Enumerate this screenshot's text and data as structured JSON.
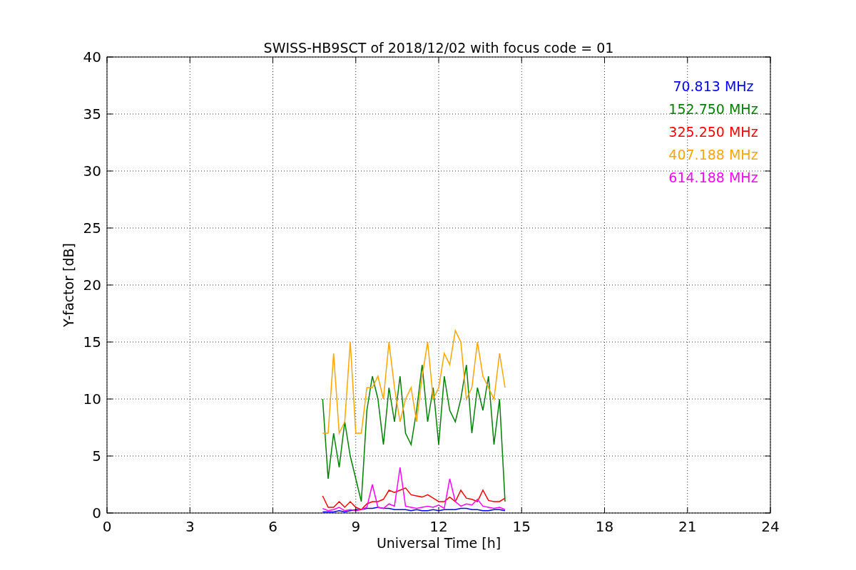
{
  "chart_data": {
    "type": "line",
    "title": "SWISS-HB9SCT of 2018/12/02 with focus code = 01",
    "xlabel": "Universal Time [h]",
    "ylabel": "Y-factor [dB]",
    "x": [
      7.8,
      8.0,
      8.2,
      8.4,
      8.6,
      8.8,
      9.0,
      9.2,
      9.4,
      9.6,
      9.8,
      10.0,
      10.2,
      10.4,
      10.6,
      10.8,
      11.0,
      11.2,
      11.4,
      11.6,
      11.8,
      12.0,
      12.2,
      12.4,
      12.6,
      12.8,
      13.0,
      13.2,
      13.4,
      13.6,
      13.8,
      14.0,
      14.2,
      14.4
    ],
    "series": [
      {
        "name": "70.813 MHz",
        "color": "#0000ff",
        "values": [
          0.1,
          0.1,
          0.1,
          0.2,
          0.1,
          0.2,
          0.3,
          0.3,
          0.4,
          0.4,
          0.5,
          0.4,
          0.4,
          0.3,
          0.3,
          0.3,
          0.2,
          0.3,
          0.2,
          0.2,
          0.3,
          0.2,
          0.3,
          0.3,
          0.3,
          0.4,
          0.4,
          0.3,
          0.3,
          0.2,
          0.2,
          0.3,
          0.3,
          0.2
        ]
      },
      {
        "name": "152.750 MHz",
        "color": "#008000",
        "values": [
          10,
          3,
          7,
          4,
          8,
          5,
          3,
          1,
          9,
          12,
          10,
          6,
          11,
          8,
          12,
          7,
          6,
          9,
          13,
          8,
          11,
          6,
          12,
          9,
          8,
          10,
          13,
          7,
          11,
          9,
          12,
          6,
          10,
          1
        ]
      },
      {
        "name": "325.250 MHz",
        "color": "#ff0000",
        "values": [
          1.5,
          0.5,
          0.5,
          1,
          0.5,
          1,
          0.5,
          0.3,
          0.8,
          1,
          1,
          1.2,
          2,
          1.8,
          2,
          2.2,
          1.6,
          1.5,
          1.4,
          1.6,
          1.3,
          1,
          1,
          1.4,
          1,
          2,
          1.3,
          1.2,
          1,
          2,
          1.1,
          1,
          1,
          1.3
        ]
      },
      {
        "name": "407.188 MHz",
        "color": "#ffa500",
        "values": [
          7,
          7,
          14,
          7,
          8,
          15,
          7,
          7,
          11,
          11,
          12,
          10,
          15,
          11,
          8,
          10,
          11,
          8,
          12,
          15,
          10,
          11,
          14,
          13,
          16,
          15,
          10,
          11,
          15,
          12,
          11,
          10,
          14,
          11
        ]
      },
      {
        "name": "614.188 MHz",
        "color": "#ff00ff",
        "values": [
          0.4,
          0.2,
          0.3,
          0.5,
          0.2,
          0.3,
          0.2,
          0.3,
          0.5,
          2.5,
          0.5,
          0.4,
          0.8,
          0.6,
          4,
          0.6,
          0.5,
          0.4,
          0.5,
          0.6,
          0.5,
          0.7,
          0.4,
          3,
          1,
          0.6,
          0.8,
          0.7,
          1.2,
          0.6,
          0.5,
          0.4,
          0.5,
          0.3
        ]
      }
    ],
    "grid": true,
    "xlim": [
      0,
      24
    ],
    "ylim": [
      0,
      40
    ],
    "xticks": [
      0,
      3,
      6,
      9,
      12,
      15,
      18,
      21,
      24
    ],
    "yticks": [
      0,
      5,
      10,
      15,
      20,
      25,
      30,
      35,
      40
    ]
  }
}
